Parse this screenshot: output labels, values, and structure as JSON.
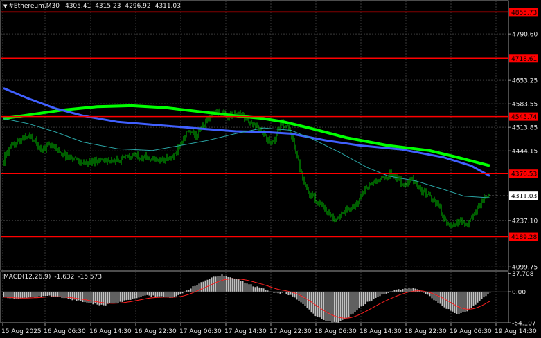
{
  "header": {
    "symbol": "#Ethereum,M30",
    "open": "4305.41",
    "high": "4315.23",
    "low": "4296.92",
    "close": "4311.03"
  },
  "macd": {
    "label": "MACD(12,26,9)",
    "value1": "-1.632",
    "value2": "-15.573",
    "scale": [
      "37.708",
      "0.00",
      "-64.107"
    ]
  },
  "price_axis": [
    "4790.60",
    "4653.25",
    "4583.55",
    "4513.85",
    "4444.15",
    "4237.10",
    "4099.75"
  ],
  "horizontal_levels": [
    {
      "price": "4855.73"
    },
    {
      "price": "4718.61"
    },
    {
      "price": "4545.74"
    },
    {
      "price": "4376.53"
    },
    {
      "price": "4189.28"
    }
  ],
  "current_price": "4311.03",
  "time_axis": [
    "15 Aug 2025",
    "16 Aug 06:30",
    "16 Aug 14:30",
    "16 Aug 22:30",
    "17 Aug 06:30",
    "17 Aug 14:30",
    "17 Aug 22:30",
    "18 Aug 06:30",
    "18 Aug 14:30",
    "18 Aug 22:30",
    "19 Aug 06:30",
    "19 Aug 14:30"
  ],
  "colors": {
    "background": "#000000",
    "candle": "#00c000",
    "grid": "#3a3a3a",
    "level_line": "#ff0000",
    "level_label_bg": "#ff0000",
    "ma_fast": "#00ff00",
    "ma_slow": "#4060ff",
    "ma_mid": "#2aa5a5",
    "macd_hist": "#c0c0c0",
    "macd_signal": "#ff2020"
  },
  "chart_data": {
    "type": "candlestick",
    "series": [
      {
        "name": "close",
        "x": [
          "15 Aug 2025",
          "16 Aug 06:30",
          "16 Aug 14:30",
          "16 Aug 22:30",
          "17 Aug 06:30",
          "17 Aug 14:30",
          "17 Aug 22:30",
          "18 Aug 06:30",
          "18 Aug 14:30",
          "18 Aug 22:30",
          "19 Aug 06:30",
          "19 Aug 14:30"
        ],
        "y": [
          4400,
          4470,
          4420,
          4440,
          4560,
          4535,
          4510,
          4270,
          4370,
          4330,
          4215,
          4311.03
        ]
      }
    ],
    "ylim": [
      4099.75,
      4888
    ]
  }
}
